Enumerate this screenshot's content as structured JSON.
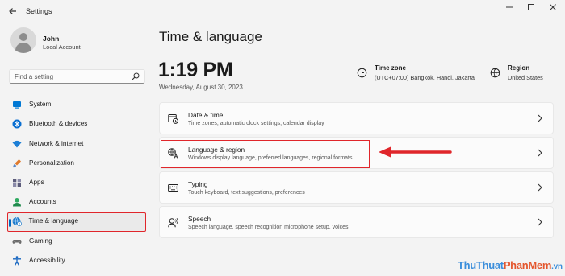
{
  "window": {
    "title": "Settings",
    "back_icon": "back-arrow-icon",
    "controls": [
      "minimize-icon",
      "maximize-icon",
      "close-icon"
    ]
  },
  "user": {
    "name": "John",
    "account_type": "Local Account"
  },
  "search": {
    "placeholder": "Find a setting",
    "icon": "search-icon"
  },
  "nav": {
    "items": [
      {
        "label": "System",
        "icon": "system-icon",
        "color": "#0078d4"
      },
      {
        "label": "Bluetooth & devices",
        "icon": "bluetooth-icon",
        "color": "#0a6fd1"
      },
      {
        "label": "Network & internet",
        "icon": "wifi-icon",
        "color": "#1d7fd6"
      },
      {
        "label": "Personalization",
        "icon": "brush-icon",
        "color": "#e07a2c"
      },
      {
        "label": "Apps",
        "icon": "apps-icon",
        "color": "#5c5c7a"
      },
      {
        "label": "Accounts",
        "icon": "accounts-icon",
        "color": "#2faa60"
      },
      {
        "label": "Time & language",
        "icon": "globe-clock-icon",
        "color": "#1b79c9",
        "active": true
      },
      {
        "label": "Gaming",
        "icon": "gaming-icon",
        "color": "#6b6b6b"
      },
      {
        "label": "Accessibility",
        "icon": "accessibility-icon",
        "color": "#1565c0"
      }
    ]
  },
  "main": {
    "title": "Time & language",
    "time": "1:19 PM",
    "date": "Wednesday, August 30, 2023",
    "time_zone": {
      "label": "Time zone",
      "value": "(UTC+07:00) Bangkok, Hanoi, Jakarta",
      "icon": "time-zone-icon"
    },
    "region": {
      "label": "Region",
      "value": "United States",
      "icon": "globe-icon"
    },
    "cards": [
      {
        "title": "Date & time",
        "subtitle": "Time zones, automatic clock settings, calendar display",
        "icon": "calendar-clock-icon"
      },
      {
        "title": "Language & region",
        "subtitle": "Windows display language, preferred languages, regional formats",
        "icon": "language-icon",
        "highlighted": true
      },
      {
        "title": "Typing",
        "subtitle": "Touch keyboard, text suggestions, preferences",
        "icon": "keyboard-icon"
      },
      {
        "title": "Speech",
        "subtitle": "Speech language, speech recognition microphone setup, voices",
        "icon": "speech-icon"
      }
    ]
  },
  "annotation": {
    "color": "#e0262b"
  },
  "watermark": {
    "part1": "ThuThuat",
    "part2": "PhanMem",
    "part3": ".vn"
  },
  "accent": "#0067c0"
}
